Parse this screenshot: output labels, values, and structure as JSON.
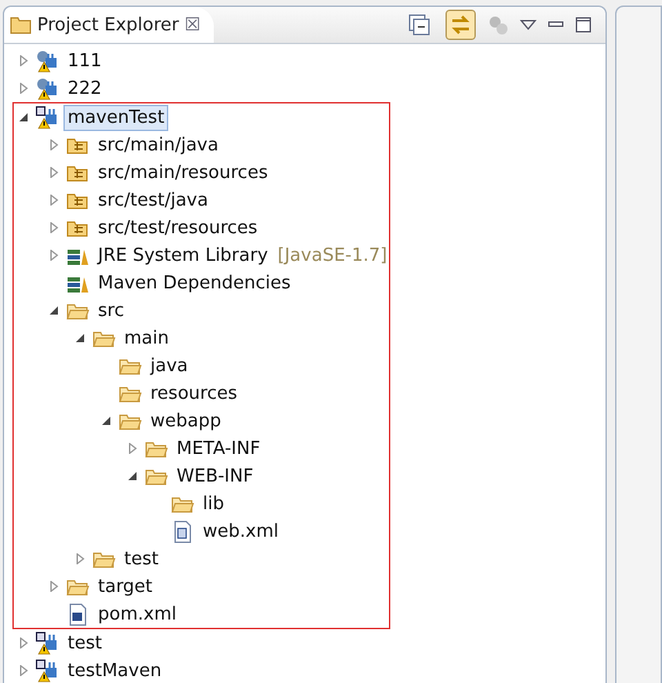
{
  "view": {
    "title": "Project Explorer",
    "close": "☒"
  },
  "tree": [
    {
      "label": "111",
      "kind": "project",
      "expanded": false,
      "selected": false,
      "framed": false
    },
    {
      "label": "222",
      "kind": "project",
      "expanded": false,
      "selected": false,
      "framed": false
    },
    {
      "label": "mavenTest",
      "kind": "maven-project",
      "expanded": true,
      "selected": true,
      "framed": true,
      "children": [
        {
          "label": "src/main/java",
          "kind": "source-folder",
          "expanded": false,
          "selected": false
        },
        {
          "label": "src/main/resources",
          "kind": "source-folder",
          "expanded": false,
          "selected": false
        },
        {
          "label": "src/test/java",
          "kind": "source-folder",
          "expanded": false,
          "selected": false
        },
        {
          "label": "src/test/resources",
          "kind": "source-folder",
          "expanded": false,
          "selected": false
        },
        {
          "label": "JRE System Library",
          "decoration": "[JavaSE-1.7]",
          "kind": "library",
          "expanded": false,
          "selected": false
        },
        {
          "label": "Maven Dependencies",
          "kind": "library",
          "selected": false
        },
        {
          "label": "src",
          "kind": "folder",
          "expanded": true,
          "selected": false,
          "children": [
            {
              "label": "main",
              "kind": "folder",
              "expanded": true,
              "selected": false,
              "children": [
                {
                  "label": "java",
                  "kind": "folder",
                  "selected": false
                },
                {
                  "label": "resources",
                  "kind": "folder",
                  "selected": false
                },
                {
                  "label": "webapp",
                  "kind": "folder",
                  "expanded": true,
                  "selected": false,
                  "children": [
                    {
                      "label": "META-INF",
                      "kind": "folder",
                      "expanded": false,
                      "selected": false
                    },
                    {
                      "label": "WEB-INF",
                      "kind": "folder",
                      "expanded": true,
                      "selected": false,
                      "children": [
                        {
                          "label": "lib",
                          "kind": "folder",
                          "selected": false
                        },
                        {
                          "label": "web.xml",
                          "kind": "xml-file",
                          "selected": false
                        }
                      ]
                    }
                  ]
                }
              ]
            },
            {
              "label": "test",
              "kind": "folder",
              "expanded": false,
              "selected": false
            }
          ]
        },
        {
          "label": "target",
          "kind": "folder",
          "expanded": false,
          "selected": false
        },
        {
          "label": "pom.xml",
          "kind": "pom-file",
          "selected": false
        }
      ]
    },
    {
      "label": "test",
      "kind": "maven-project",
      "expanded": false,
      "selected": false,
      "framed": false
    },
    {
      "label": "testMaven",
      "kind": "maven-project",
      "expanded": false,
      "selected": false,
      "framed": false
    }
  ]
}
